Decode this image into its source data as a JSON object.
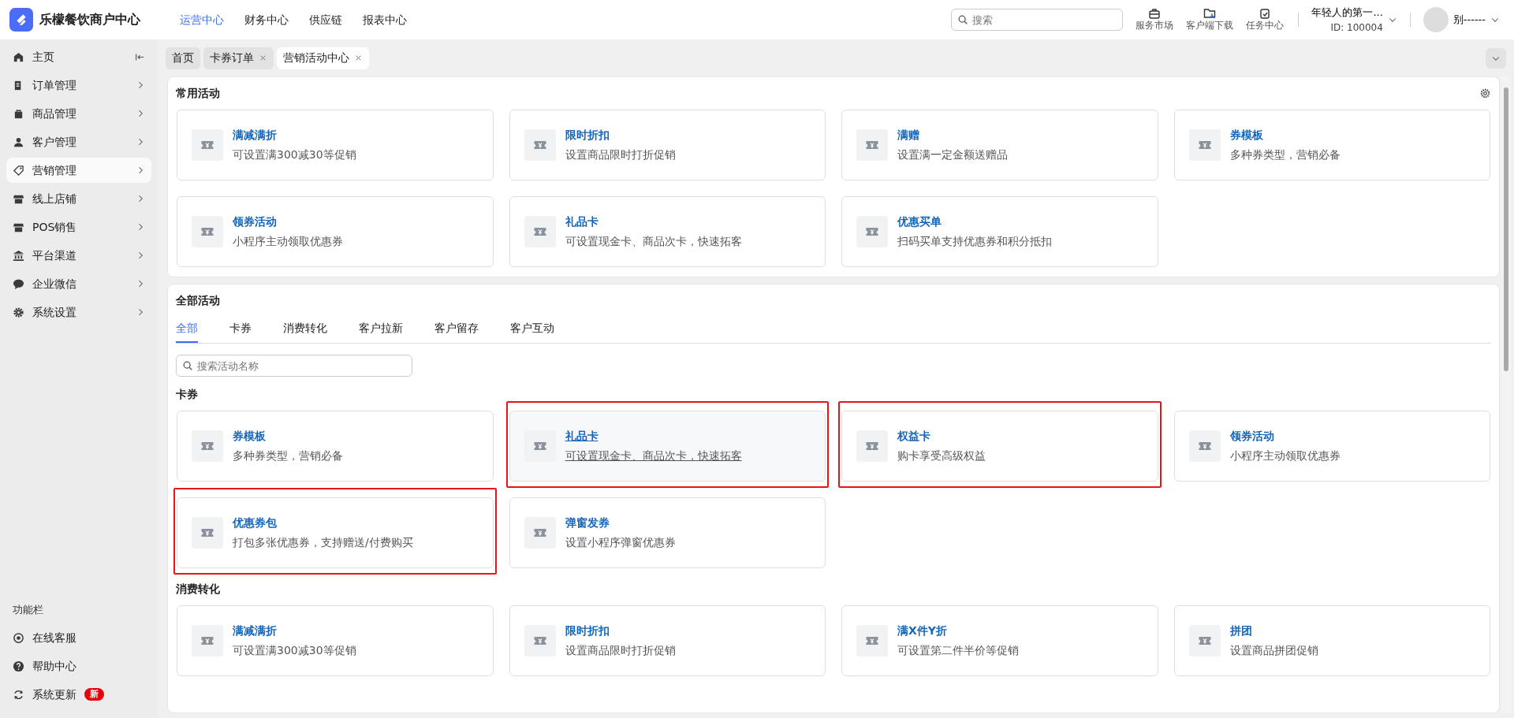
{
  "app": {
    "title": "乐檬餐饮商户中心"
  },
  "top_nav": [
    {
      "label": "运营中心",
      "selected": true
    },
    {
      "label": "财务中心",
      "selected": false
    },
    {
      "label": "供应链",
      "selected": false
    },
    {
      "label": "报表中心",
      "selected": false
    }
  ],
  "header": {
    "search": {
      "placeholder": "搜索"
    },
    "tools": [
      {
        "label": "服务市场"
      },
      {
        "label": "客户端下载"
      },
      {
        "label": "任务中心"
      }
    ],
    "account": {
      "name": "年轻人的第一...",
      "id": "ID: 100004"
    },
    "user": {
      "name": "别------"
    }
  },
  "sidebar": {
    "items": [
      {
        "label": "主页",
        "selected": false,
        "kind": "collapse"
      },
      {
        "label": "订单管理",
        "selected": false,
        "kind": "chevron"
      },
      {
        "label": "商品管理",
        "selected": false,
        "kind": "chevron"
      },
      {
        "label": "客户管理",
        "selected": false,
        "kind": "chevron"
      },
      {
        "label": "营销管理",
        "selected": true,
        "kind": "chevron"
      },
      {
        "label": "线上店铺",
        "selected": false,
        "kind": "chevron"
      },
      {
        "label": "POS销售",
        "selected": false,
        "kind": "chevron"
      },
      {
        "label": "平台渠道",
        "selected": false,
        "kind": "chevron"
      },
      {
        "label": "企业微信",
        "selected": false,
        "kind": "chevron"
      },
      {
        "label": "系统设置",
        "selected": false,
        "kind": "chevron"
      }
    ],
    "footer_title": "功能栏",
    "footer_items": [
      {
        "label": "在线客服"
      },
      {
        "label": "帮助中心"
      },
      {
        "label": "系统更新",
        "badge": "新"
      }
    ]
  },
  "page_tabs": [
    {
      "label": "首页",
      "selected": false,
      "closable": false
    },
    {
      "label": "卡券订单",
      "selected": false,
      "closable": true
    },
    {
      "label": "营销活动中心",
      "selected": true,
      "closable": true
    }
  ],
  "common": {
    "title": "常用活动",
    "cards": [
      {
        "title": "满减满折",
        "desc": "可设置满300减30等促销",
        "hovered": false,
        "highlighted": false
      },
      {
        "title": "限时折扣",
        "desc": "设置商品限时打折促销",
        "hovered": false,
        "highlighted": false
      },
      {
        "title": "满赠",
        "desc": "设置满一定金额送赠品",
        "hovered": false,
        "highlighted": false
      },
      {
        "title": "券模板",
        "desc": "多种券类型，营销必备",
        "hovered": false,
        "highlighted": false
      },
      {
        "title": "领券活动",
        "desc": "小程序主动领取优惠券",
        "hovered": false,
        "highlighted": false
      },
      {
        "title": "礼品卡",
        "desc": "可设置现金卡、商品次卡，快速拓客",
        "hovered": false,
        "highlighted": false
      },
      {
        "title": "优惠买单",
        "desc": "扫码买单支持优惠券和积分抵扣",
        "hovered": false,
        "highlighted": false
      }
    ]
  },
  "all": {
    "title": "全部活动",
    "tabs": [
      {
        "label": "全部",
        "selected": true
      },
      {
        "label": "卡券",
        "selected": false
      },
      {
        "label": "消费转化",
        "selected": false
      },
      {
        "label": "客户拉新",
        "selected": false
      },
      {
        "label": "客户留存",
        "selected": false
      },
      {
        "label": "客户互动",
        "selected": false
      }
    ],
    "search": {
      "placeholder": "搜索活动名称"
    },
    "groups": [
      {
        "title": "卡券",
        "cards": [
          {
            "title": "券模板",
            "desc": "多种券类型，营销必备",
            "hovered": false,
            "highlighted": false
          },
          {
            "title": "礼品卡",
            "desc": "可设置现金卡、商品次卡，快速拓客",
            "hovered": true,
            "highlighted": true
          },
          {
            "title": "权益卡",
            "desc": "购卡享受高级权益",
            "hovered": false,
            "highlighted": true
          },
          {
            "title": "领券活动",
            "desc": "小程序主动领取优惠券",
            "hovered": false,
            "highlighted": false
          },
          {
            "title": "优惠券包",
            "desc": "打包多张优惠券，支持赠送/付费购买",
            "hovered": false,
            "highlighted": true
          },
          {
            "title": "弹窗发券",
            "desc": "设置小程序弹窗优惠券",
            "hovered": false,
            "highlighted": false
          }
        ]
      },
      {
        "title": "消费转化",
        "cards": [
          {
            "title": "满减满折",
            "desc": "可设置满300减30等促销",
            "hovered": false,
            "highlighted": false
          },
          {
            "title": "限时折扣",
            "desc": "设置商品限时打折促销",
            "hovered": false,
            "highlighted": false
          },
          {
            "title": "满X件Y折",
            "desc": "可设置第二件半价等促销",
            "hovered": false,
            "highlighted": false
          },
          {
            "title": "拼团",
            "desc": "设置商品拼团促销",
            "hovered": false,
            "highlighted": false
          }
        ]
      }
    ]
  }
}
